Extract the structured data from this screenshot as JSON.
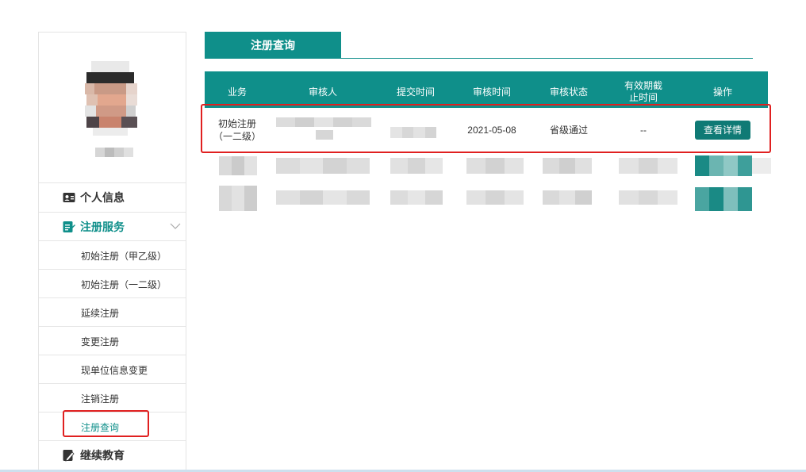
{
  "sidebar": {
    "menu": [
      {
        "label": "个人信息",
        "icon": "id-card-icon"
      },
      {
        "label": "注册服务",
        "icon": "edit-doc-icon"
      }
    ],
    "submenu": [
      {
        "label": "初始注册（甲乙级）"
      },
      {
        "label": "初始注册（一二级）"
      },
      {
        "label": "延续注册"
      },
      {
        "label": "变更注册"
      },
      {
        "label": "现单位信息变更"
      },
      {
        "label": "注销注册"
      },
      {
        "label": "注册查询"
      }
    ],
    "bottom_menu": {
      "label": "继续教育",
      "icon": "pencil-doc-icon"
    }
  },
  "tab": {
    "label": "注册查询"
  },
  "table": {
    "headers": [
      "业务",
      "审核人",
      "提交时间",
      "审核时间",
      "审核状态",
      "有效期截止时间",
      "操作"
    ],
    "rows": [
      {
        "business": "初始注册\n（一二级）",
        "review_time": "2021-05-08",
        "status": "省级通过",
        "expiry": "--",
        "action": "查看详情"
      }
    ]
  },
  "colors": {
    "accent": "#0f8f8a",
    "highlight_border": "#e02020"
  }
}
